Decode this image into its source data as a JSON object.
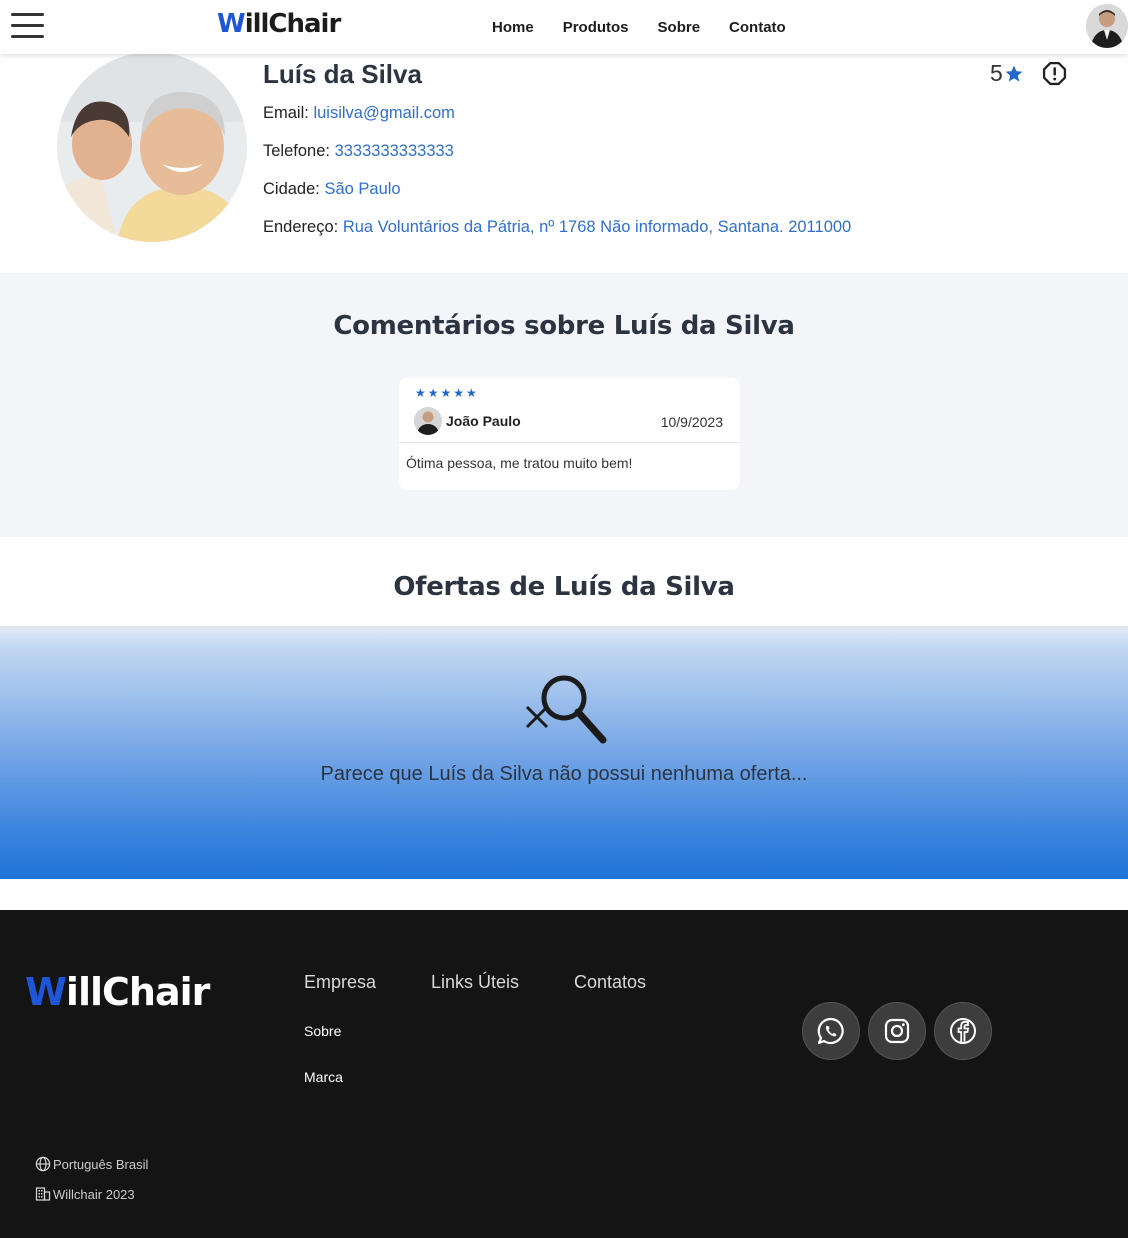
{
  "nav": {
    "logo_w": "W",
    "logo_rest": "illChair",
    "links": [
      "Home",
      "Produtos",
      "Sobre",
      "Contato"
    ]
  },
  "profile": {
    "name": "Luís da Silva",
    "rating": "5",
    "email_label": "Email:",
    "email": "luisilva@gmail.com",
    "phone_label": "Telefone:",
    "phone": "3333333333333",
    "city_label": "Cidade:",
    "city": "São Paulo",
    "address_label": "Endereço:",
    "address": "Rua Voluntários da Pátria, nº 1768 Não informado, Santana. 2011000"
  },
  "comments": {
    "title": "Comentários sobre Luís da Silva",
    "items": [
      {
        "stars": "★★★★★",
        "author": "João Paulo",
        "date": "10/9/2023",
        "text": "Ótima pessoa, me tratou muito bem!"
      }
    ]
  },
  "offers": {
    "title": "Ofertas de Luís da Silva",
    "empty_message": "Parece que Luís da Silva não possui nenhuma oferta..."
  },
  "footer": {
    "logo_w": "W",
    "logo_rest": "illChair",
    "columns": [
      "Empresa",
      "Links Úteis",
      "Contatos"
    ],
    "empresa_links": [
      "Sobre",
      "Marca"
    ],
    "language": "Português Brasil",
    "copyright": "Willchair 2023",
    "social": [
      "whatsapp-icon",
      "instagram-icon",
      "facebook-icon"
    ]
  },
  "colors": {
    "brand_blue": "#1f56d8",
    "link_blue": "#2f6fd0",
    "footer_bg": "#141414"
  }
}
